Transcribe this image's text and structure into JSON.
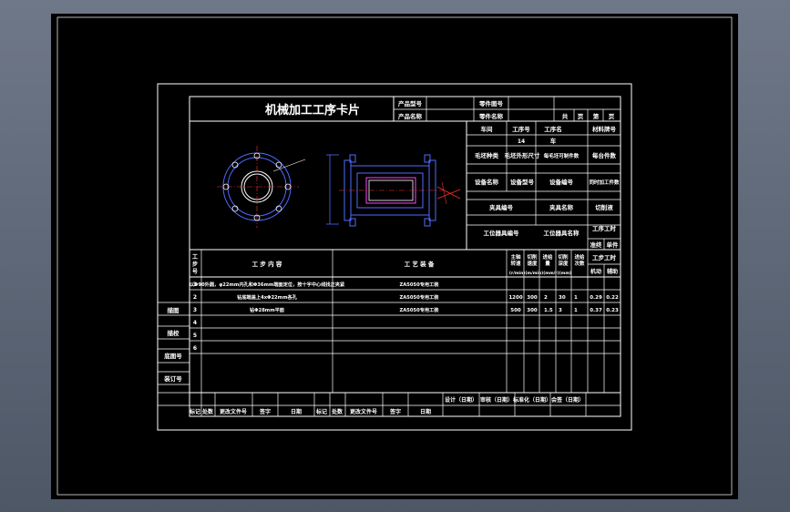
{
  "colors": {
    "viewport_bg": "#56606f",
    "paper": "#000000",
    "line": "#ffffff",
    "part": "#4f6bff",
    "magenta": "#ff40ff",
    "red": "#ff3030"
  },
  "card": {
    "title": "机械加工工序卡片",
    "product_model_label": "产品型号",
    "part_drawing_no_label": "零件图号",
    "product_name_label": "产品名称",
    "part_name_label": "零件名称",
    "total_label": "共",
    "page_label": "页",
    "sheet_label": "第",
    "sheet_page_label": "页"
  },
  "info": {
    "workshop_label": "车间",
    "process_no_label": "工序号",
    "process_name_label": "工序名",
    "material_label": "材料牌号",
    "process_no_value": "14",
    "process_name_value": "车",
    "blank_type_label": "毛坯种类",
    "blank_size_label": "毛坯外形尺寸",
    "blank_pieces_label": "每毛坯可制件数",
    "per_unit_label": "每台件数",
    "equip_name_label": "设备名称",
    "equip_model_label": "设备型号",
    "equip_no_label": "设备编号",
    "simul_label": "同时加工件数",
    "fixture_no_label": "夹具编号",
    "fixture_name_label": "夹具名称",
    "coolant_label": "切削液",
    "tool_no_label": "工位器具编号",
    "tool_name_label": "工位器具名称",
    "hours_label": "工序工时",
    "prep_label": "准终",
    "unit_label": "单件"
  },
  "steps": {
    "headers": {
      "step_no": "工步号",
      "content": "工  步  内  容",
      "equipment": "工  艺  装  备",
      "spindle": "主轴转速",
      "speed": "切削速度",
      "feed": "进给量",
      "depth": "切削深度",
      "passes": "进给次数",
      "hours": "工步工时",
      "units": "(r/min)(m/min)(mm/r)(mm)",
      "machine": "机动",
      "aux": "辅助"
    },
    "rows": [
      {
        "no": "1",
        "content": "以Φ90外圆，φ22mm内孔和Φ36mm端面定位，按十字中心线找正夹紧",
        "equip": "ZA5050专用工装",
        "spindle": "",
        "speed": "",
        "feed": "",
        "depth": "",
        "passes": "",
        "mach": "",
        "aux": ""
      },
      {
        "no": "2",
        "content": "钻底端盖上4xΦ22mm各孔",
        "equip": "ZA5050专用工装",
        "spindle": "1200",
        "speed": "300",
        "feed": "2",
        "depth": "30",
        "passes": "1",
        "mach": "0.29",
        "aux": "0.22"
      },
      {
        "no": "3",
        "content": "钻Φ28mm平面",
        "equip": "ZA5050专用工装",
        "spindle": "500",
        "speed": "300",
        "feed": "1.5",
        "depth": "3",
        "passes": "1",
        "mach": "0.37",
        "aux": "0.23"
      },
      {
        "no": "4",
        "content": "",
        "equip": "",
        "spindle": "",
        "speed": "",
        "feed": "",
        "depth": "",
        "passes": "",
        "mach": "",
        "aux": ""
      },
      {
        "no": "5",
        "content": "",
        "equip": "",
        "spindle": "",
        "speed": "",
        "feed": "",
        "depth": "",
        "passes": "",
        "mach": "",
        "aux": ""
      },
      {
        "no": "6",
        "content": "",
        "equip": "",
        "spindle": "",
        "speed": "",
        "feed": "",
        "depth": "",
        "passes": "",
        "mach": "",
        "aux": ""
      }
    ]
  },
  "side": {
    "draw": "描图",
    "trace": "描校",
    "base_no": "底图号",
    "binding_no": "装订号"
  },
  "signoff": {
    "design": "设计（日期）",
    "review": "审核（日期）",
    "standard": "标准化（日期）",
    "countersign": "会签（日期）"
  },
  "revision": {
    "mark": "标记",
    "count": "处数",
    "doc_no": "更改文件号",
    "signature": "签字",
    "date": "日期",
    "mark2": "标记",
    "count2": "处数",
    "doc_no2": "更改文件号",
    "signature2": "签字",
    "date2": "日期"
  }
}
